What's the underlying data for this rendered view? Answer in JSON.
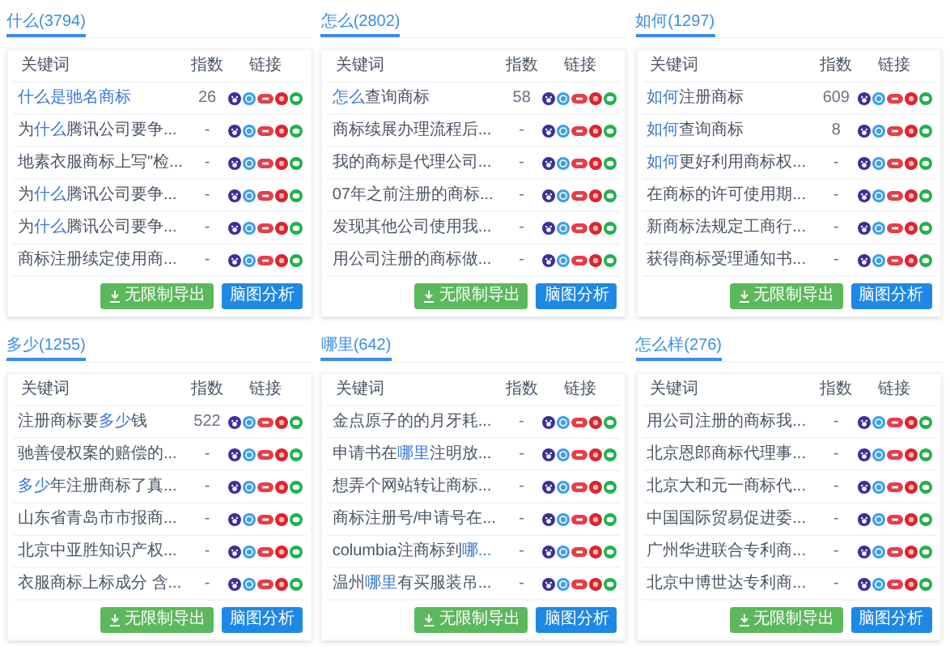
{
  "panels": [
    {
      "tab": {
        "label": "什么(3794)",
        "selected": true
      },
      "columns": [
        "关键词",
        "指数",
        "链接"
      ],
      "rows": [
        {
          "keyword": [
            {
              "text": "什么是驰名商标",
              "highlight": true
            }
          ],
          "index": "26"
        },
        {
          "keyword": [
            {
              "text": "为",
              "highlight": false
            },
            {
              "text": "什么",
              "highlight": true
            },
            {
              "text": "腾讯公司要争...",
              "highlight": false
            }
          ],
          "index": "-"
        },
        {
          "keyword": [
            {
              "text": "地素衣服商标上写\"检...",
              "highlight": false
            }
          ],
          "index": "-"
        },
        {
          "keyword": [
            {
              "text": "为",
              "highlight": false
            },
            {
              "text": "什么",
              "highlight": true
            },
            {
              "text": "腾讯公司要争...",
              "highlight": false
            }
          ],
          "index": "-"
        },
        {
          "keyword": [
            {
              "text": "为",
              "highlight": false
            },
            {
              "text": "什么",
              "highlight": true
            },
            {
              "text": "腾讯公司要争...",
              "highlight": false
            }
          ],
          "index": "-"
        },
        {
          "keyword": [
            {
              "text": "商标注册续定使用商...",
              "highlight": false
            }
          ],
          "index": "-"
        }
      ],
      "buttons": [
        {
          "label": "无限制导出",
          "kind": "export"
        },
        {
          "label": "脑图分析",
          "kind": "analysis"
        }
      ]
    },
    {
      "tab": {
        "label": "怎么(2802)",
        "selected": true
      },
      "columns": [
        "关键词",
        "指数",
        "链接"
      ],
      "rows": [
        {
          "keyword": [
            {
              "text": "怎么",
              "highlight": true
            },
            {
              "text": "查询商标",
              "highlight": false
            }
          ],
          "index": "58"
        },
        {
          "keyword": [
            {
              "text": "商标续展办理流程后...",
              "highlight": false
            }
          ],
          "index": "-"
        },
        {
          "keyword": [
            {
              "text": "我的商标是代理公司...",
              "highlight": false
            }
          ],
          "index": "-"
        },
        {
          "keyword": [
            {
              "text": "07年之前注册的商标...",
              "highlight": false
            }
          ],
          "index": "-"
        },
        {
          "keyword": [
            {
              "text": "发现其他公司使用我...",
              "highlight": false
            }
          ],
          "index": "-"
        },
        {
          "keyword": [
            {
              "text": "用公司注册的商标做...",
              "highlight": false
            }
          ],
          "index": "-"
        }
      ],
      "buttons": [
        {
          "label": "无限制导出",
          "kind": "export"
        },
        {
          "label": "脑图分析",
          "kind": "analysis"
        }
      ]
    },
    {
      "tab": {
        "label": "如何(1297)",
        "selected": true
      },
      "columns": [
        "关键词",
        "指数",
        "链接"
      ],
      "rows": [
        {
          "keyword": [
            {
              "text": "如何",
              "highlight": true
            },
            {
              "text": "注册商标",
              "highlight": false
            }
          ],
          "index": "609"
        },
        {
          "keyword": [
            {
              "text": "如何",
              "highlight": true
            },
            {
              "text": "查询商标",
              "highlight": false
            }
          ],
          "index": "8"
        },
        {
          "keyword": [
            {
              "text": "如何",
              "highlight": true
            },
            {
              "text": "更好利用商标权...",
              "highlight": false
            }
          ],
          "index": "-"
        },
        {
          "keyword": [
            {
              "text": "在商标的许可使用期...",
              "highlight": false
            }
          ],
          "index": "-"
        },
        {
          "keyword": [
            {
              "text": "新商标法规定工商行...",
              "highlight": false
            }
          ],
          "index": "-"
        },
        {
          "keyword": [
            {
              "text": "获得商标受理通知书...",
              "highlight": false
            }
          ],
          "index": "-"
        }
      ],
      "buttons": [
        {
          "label": "无限制导出",
          "kind": "export"
        },
        {
          "label": "脑图分析",
          "kind": "analysis"
        }
      ]
    },
    {
      "tab": {
        "label": "多少(1255)",
        "selected": true
      },
      "columns": [
        "关键词",
        "指数",
        "链接"
      ],
      "rows": [
        {
          "keyword": [
            {
              "text": "注册商标要",
              "highlight": false
            },
            {
              "text": "多少",
              "highlight": true
            },
            {
              "text": "钱",
              "highlight": false
            }
          ],
          "index": "522"
        },
        {
          "keyword": [
            {
              "text": "驰善侵权案的赔偿的...",
              "highlight": false
            }
          ],
          "index": "-"
        },
        {
          "keyword": [
            {
              "text": "多少",
              "highlight": true
            },
            {
              "text": "年注册商标了真...",
              "highlight": false
            }
          ],
          "index": "-"
        },
        {
          "keyword": [
            {
              "text": "山东省青岛市市报商...",
              "highlight": false
            }
          ],
          "index": "-"
        },
        {
          "keyword": [
            {
              "text": "北京中亚胜知识产权...",
              "highlight": false
            }
          ],
          "index": "-"
        },
        {
          "keyword": [
            {
              "text": "衣服商标上标成分 含...",
              "highlight": false
            }
          ],
          "index": "-"
        }
      ],
      "buttons": [
        {
          "label": "无限制导出",
          "kind": "export"
        },
        {
          "label": "脑图分析",
          "kind": "analysis"
        }
      ]
    },
    {
      "tab": {
        "label": "哪里(642)",
        "selected": true
      },
      "columns": [
        "关键词",
        "指数",
        "链接"
      ],
      "rows": [
        {
          "keyword": [
            {
              "text": "金点原子的的月牙耗...",
              "highlight": false
            }
          ],
          "index": "-"
        },
        {
          "keyword": [
            {
              "text": "申请书在",
              "highlight": false
            },
            {
              "text": "哪里",
              "highlight": true
            },
            {
              "text": "注明放...",
              "highlight": false
            }
          ],
          "index": "-"
        },
        {
          "keyword": [
            {
              "text": "想弄个网站转让商标...",
              "highlight": false
            }
          ],
          "index": "-"
        },
        {
          "keyword": [
            {
              "text": "商标注册号/申请号在...",
              "highlight": false
            }
          ],
          "index": "-"
        },
        {
          "keyword": [
            {
              "text": "columbia注商标到",
              "highlight": false
            },
            {
              "text": "哪...",
              "highlight": true
            }
          ],
          "index": "-"
        },
        {
          "keyword": [
            {
              "text": "温州",
              "highlight": false
            },
            {
              "text": "哪里",
              "highlight": true
            },
            {
              "text": "有买服装吊...",
              "highlight": false
            }
          ],
          "index": "-"
        }
      ],
      "buttons": [
        {
          "label": "无限制导出",
          "kind": "export"
        },
        {
          "label": "脑图分析",
          "kind": "analysis"
        }
      ]
    },
    {
      "tab": {
        "label": "怎么样(276)",
        "selected": true
      },
      "columns": [
        "关键词",
        "指数",
        "链接"
      ],
      "rows": [
        {
          "keyword": [
            {
              "text": "用公司注册的商标我...",
              "highlight": false
            }
          ],
          "index": "-"
        },
        {
          "keyword": [
            {
              "text": "北京恩郎商标代理事...",
              "highlight": false
            }
          ],
          "index": "-"
        },
        {
          "keyword": [
            {
              "text": "北京大和元一商标代...",
              "highlight": false
            }
          ],
          "index": "-"
        },
        {
          "keyword": [
            {
              "text": "中国国际贸易促进委...",
              "highlight": false
            }
          ],
          "index": "-"
        },
        {
          "keyword": [
            {
              "text": "广州华进联合专利商...",
              "highlight": false
            }
          ],
          "index": "-"
        },
        {
          "keyword": [
            {
              "text": "北京中博世达专利商...",
              "highlight": false
            }
          ],
          "index": "-"
        }
      ],
      "buttons": [
        {
          "label": "无限制导出",
          "kind": "export"
        },
        {
          "label": "脑图分析",
          "kind": "analysis"
        }
      ]
    }
  ]
}
